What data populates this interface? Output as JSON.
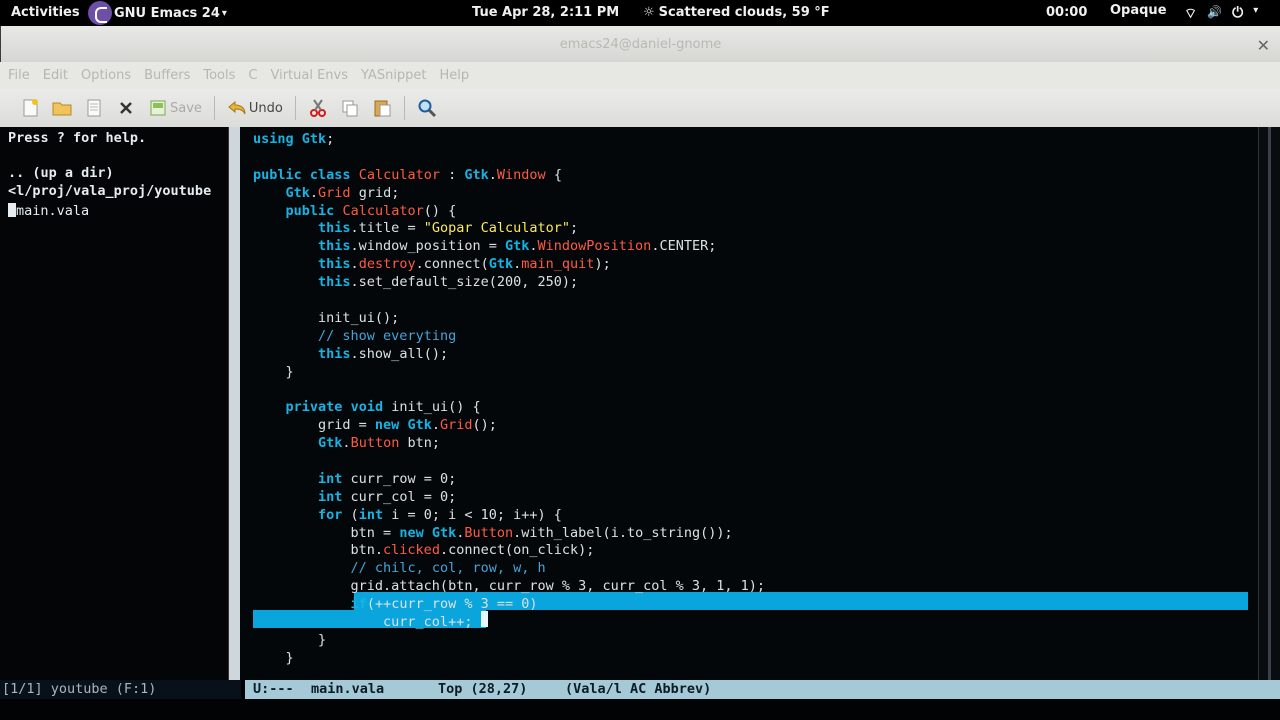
{
  "topbar": {
    "activities": "Activities",
    "app_name": "GNU Emacs 24",
    "app_caret": "▾",
    "clock": "Tue Apr 28,  2:11 PM",
    "weather": "Scattered clouds, 59 °F",
    "weather_icon": "☼",
    "timer": "00:00",
    "opacity": "Opaque",
    "tray_wifi": "⌔",
    "tray_volume": "🔊",
    "tray_power": "⏻",
    "tray_caret": "▾"
  },
  "window": {
    "title": "emacs24@daniel-gnome",
    "close": "✕"
  },
  "menubar": [
    "File",
    "Edit",
    "Options",
    "Buffers",
    "Tools",
    "C",
    "Virtual Envs",
    "YASnippet",
    "Help"
  ],
  "toolbar": {
    "save_label": "Save",
    "undo_label": "Undo"
  },
  "dired": {
    "help": "Press ? for help.",
    "up": ".. (up a dir)",
    "path": "<l/proj/vala_proj/youtube",
    "file": "main.vala"
  },
  "code_lines": [
    "using Gtk;",
    "",
    "public class Calculator : Gtk.Window {",
    "    Gtk.Grid grid;",
    "    public Calculator() {",
    "        this.title = \"Gopar Calculator\";",
    "        this.window_position = Gtk.WindowPosition.CENTER;",
    "        this.destroy.connect(Gtk.main_quit);",
    "        this.set_default_size(200, 250);",
    "",
    "        init_ui();",
    "        // show everyting",
    "        this.show_all();",
    "    }",
    "",
    "    private void init_ui() {",
    "        grid = new Gtk.Grid();",
    "        Gtk.Button btn;",
    "",
    "        int curr_row = 0;",
    "        int curr_col = 0;",
    "        for (int i = 0; i < 10; i++) {",
    "            btn = new Gtk.Button.with_label(i.to_string());",
    "            btn.clicked.connect(on_click);",
    "            // chilc, col, row, w, h",
    "            grid.attach(btn, curr_row % 3, curr_col % 3, 1, 1);",
    "            if(++curr_row % 3 == 0)",
    "                curr_col++;",
    "        }",
    "    }"
  ],
  "modeline_left": "[1/1] youtube (F:1)",
  "modeline_right": {
    "status": "U:---",
    "buffer": "main.vala",
    "position": "Top (28,27)",
    "modes": "(Vala/l AC Abbrev)"
  },
  "colors": {
    "keyword": "#16b3e3",
    "type": "#ff5a44",
    "string": "#fbe95e",
    "comment": "#44a4d8",
    "region_highlight": "#0aa5dc",
    "modeline_active": "#a5c9d6"
  }
}
